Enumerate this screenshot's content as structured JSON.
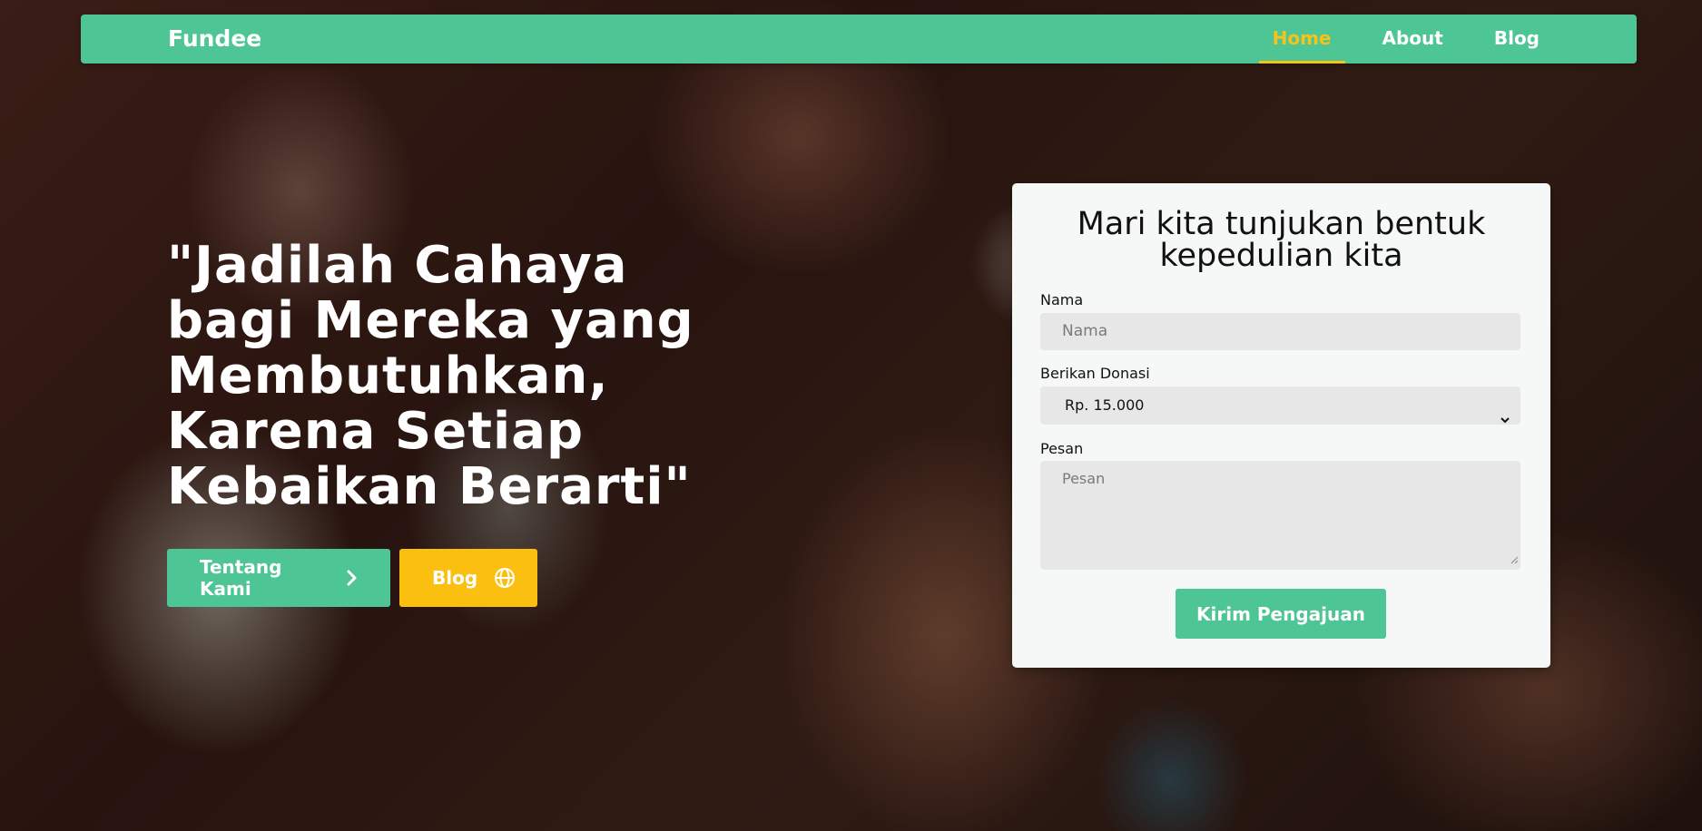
{
  "navbar": {
    "brand": "Fundee",
    "links": [
      {
        "label": "Home",
        "active": true
      },
      {
        "label": "About",
        "active": false
      },
      {
        "label": "Blog",
        "active": false
      }
    ]
  },
  "hero": {
    "title": "\"Jadilah Cahaya bagi Mereka yang Membutuhkan, Karena Setiap Kebaikan Berarti\"",
    "buttons": [
      {
        "label": "Tentang Kami",
        "icon": "chevron-right-icon"
      },
      {
        "label": "Blog",
        "icon": "globe-icon"
      }
    ]
  },
  "form": {
    "title": "Mari kita tunjukan bentuk kepedulian kita",
    "nama": {
      "label": "Nama",
      "placeholder": "Nama",
      "value": ""
    },
    "donasi": {
      "label": "Berikan Donasi",
      "selected": "Rp. 15.000"
    },
    "pesan": {
      "label": "Pesan",
      "placeholder": "Pesan",
      "value": ""
    },
    "submit_label": "Kirim Pengajuan"
  },
  "colors": {
    "primary_green": "#4ec594",
    "accent_yellow": "#fbbf10",
    "active_link": "#f6c31a",
    "card_background": "#f5f8f7",
    "field_background": "#e7e7e7"
  }
}
